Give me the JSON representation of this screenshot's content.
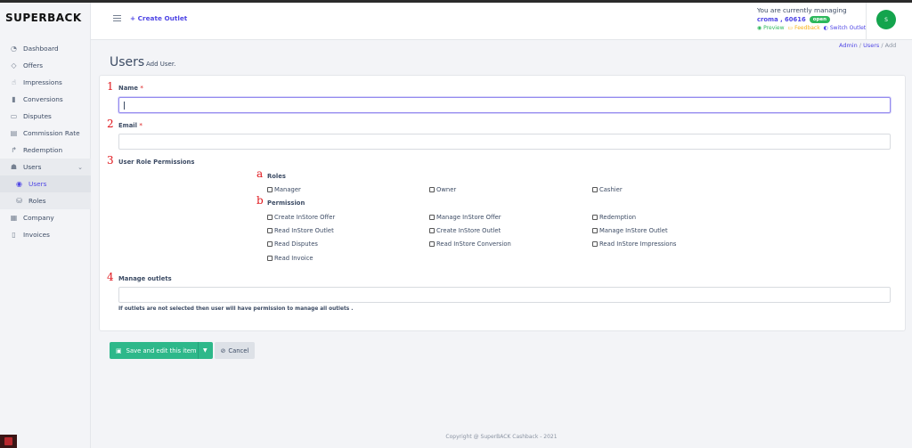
{
  "brand": "SUPERBACK",
  "header": {
    "create_outlet": "+ Create Outlet",
    "managing_text": "You are currently managing",
    "outlet_name": "croma , 60616",
    "outlet_status": "open",
    "preview": "Preview",
    "feedback": "Feedback",
    "switch_outlet": "Switch Outlet",
    "avatar_initial": "S"
  },
  "sidebar": {
    "items": [
      {
        "label": "Dashboard",
        "icon": "gauge-icon"
      },
      {
        "label": "Offers",
        "icon": "tag-icon"
      },
      {
        "label": "Impressions",
        "icon": "pointer-icon"
      },
      {
        "label": "Conversions",
        "icon": "bar-chart-icon"
      },
      {
        "label": "Disputes",
        "icon": "monitor-icon"
      },
      {
        "label": "Commission Rate",
        "icon": "card-icon"
      },
      {
        "label": "Redemption",
        "icon": "share-icon"
      },
      {
        "label": "Users",
        "icon": "users-icon"
      },
      {
        "label": "Users",
        "icon": "eye-icon"
      },
      {
        "label": "Roles",
        "icon": "database-icon"
      },
      {
        "label": "Company",
        "icon": "building-icon"
      },
      {
        "label": "Invoices",
        "icon": "document-icon"
      }
    ]
  },
  "breadcrumb": {
    "admin": "Admin",
    "sep": "/",
    "users": "Users",
    "add": "Add"
  },
  "page": {
    "title": "Users",
    "subtitle": "Add User."
  },
  "form": {
    "markers": {
      "m1": "1",
      "m2": "2",
      "m3": "3",
      "m4": "4",
      "ma": "a",
      "mb": "b"
    },
    "name_label": "Name",
    "required_mark": "*",
    "email_label": "Email",
    "permissions_label": "User Role Permissions",
    "roles_label": "Roles",
    "permission_label": "Permission",
    "roles": [
      "Manager",
      "Owner",
      "Cashier"
    ],
    "permissions": [
      "Create InStore Offer",
      "Manage InStore Offer",
      "Redemption",
      "Read InStore Outlet",
      "Create InStore Outlet",
      "Manage InStore Outlet",
      "Read Disputes",
      "Read InStore Conversion",
      "Read InStore Impressions",
      "Read Invoice"
    ],
    "outlets_label": "Manage outlets",
    "outlets_note": "If outlets are not selected then user will have permission to manage all outlets ."
  },
  "actions": {
    "save": "Save and edit this item",
    "cancel": "Cancel"
  },
  "footer": "Copyright @ SuperBACK Cashback - 2021"
}
